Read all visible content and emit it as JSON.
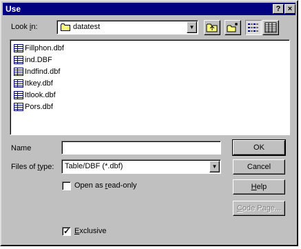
{
  "window": {
    "title": "Use",
    "help_label": "?",
    "close_label": "×"
  },
  "lookin": {
    "label_pre": "Look ",
    "label_u": "i",
    "label_post": "n:",
    "value": "datatest",
    "dropdown_arrow": "▼"
  },
  "toolbar_icons": [
    "up-folder-icon",
    "new-folder-icon",
    "list-view-icon",
    "details-view-icon"
  ],
  "files": [
    "Fillphon.dbf",
    "ind.DBF",
    "Indfind.dbf",
    "Itkey.dbf",
    "Itlook.dbf",
    "Pors.dbf"
  ],
  "name_field": {
    "label": "Name",
    "value": ""
  },
  "filetype": {
    "label_pre": "Files of ",
    "label_u": "t",
    "label_post": "ype:",
    "value": "Table/DBF (*.dbf)",
    "dropdown_arrow": "▼"
  },
  "readonly": {
    "label_pre": "Open as ",
    "label_u": "r",
    "label_post": "ead-only",
    "checked": false
  },
  "exclusive": {
    "label_u": "E",
    "label_post": "xclusive",
    "checked": true
  },
  "buttons": {
    "ok": "OK",
    "cancel": "Cancel",
    "help_u": "H",
    "help_post": "elp",
    "codepage_u": "C",
    "codepage_post": "ode Page..."
  }
}
